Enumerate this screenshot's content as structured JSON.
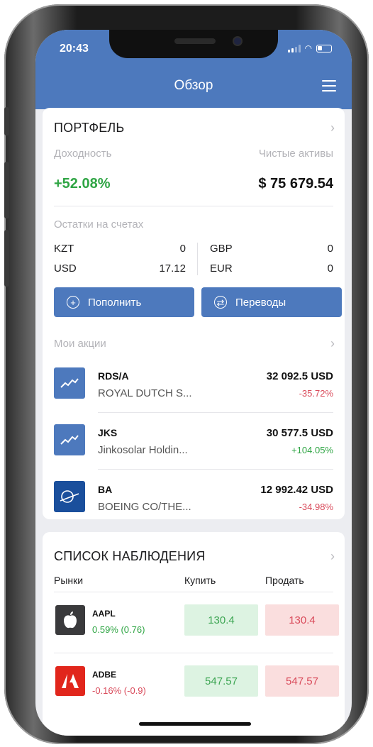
{
  "status": {
    "time": "20:43"
  },
  "nav": {
    "title": "Обзор",
    "menu_icon": "hamburger-icon"
  },
  "portfolio": {
    "title": "ПОРТФЕЛЬ",
    "profit_label": "Доходность",
    "net_label": "Чистые активы",
    "profit_value": "+52.08%",
    "net_value": "$ 75 679.54",
    "balances_label": "Остатки на счетах",
    "balances": [
      {
        "currency": "KZT",
        "amount": "0"
      },
      {
        "currency": "USD",
        "amount": "17.12"
      },
      {
        "currency": "GBP",
        "amount": "0"
      },
      {
        "currency": "EUR",
        "amount": "0"
      }
    ],
    "topup_label": "Пополнить",
    "transfer_label": "Переводы"
  },
  "stocks": {
    "title": "Мои акции",
    "items": [
      {
        "symbol": "RDS/A",
        "name": "ROYAL DUTCH S...",
        "value": "32 092.5 USD",
        "change": "-35.72%",
        "direction": "down",
        "icon": "trend-chart-icon"
      },
      {
        "symbol": "JKS",
        "name": "Jinkosolar Holdin...",
        "value": "30 577.5 USD",
        "change": "+104.05%",
        "direction": "up",
        "icon": "trend-chart-icon"
      },
      {
        "symbol": "BA",
        "name": "BOEING CO/THE...",
        "value": "12 992.42 USD",
        "change": "-34.98%",
        "direction": "down",
        "icon": "boeing-logo-icon"
      }
    ]
  },
  "watchlist": {
    "title": "СПИСОК НАБЛЮДЕНИЯ",
    "col_markets": "Рынки",
    "col_buy": "Купить",
    "col_sell": "Продать",
    "items": [
      {
        "symbol": "AAPL",
        "change": "0.59% (0.76)",
        "direction": "up",
        "buy": "130.4",
        "sell": "130.4",
        "icon": "apple-logo-icon"
      },
      {
        "symbol": "ADBE",
        "change": "-0.16% (-0.9)",
        "direction": "down",
        "buy": "547.57",
        "sell": "547.57",
        "icon": "adobe-logo-icon"
      }
    ]
  },
  "colors": {
    "header": "#4d79bd",
    "positive": "#2fa544",
    "negative": "#d94a5a"
  }
}
